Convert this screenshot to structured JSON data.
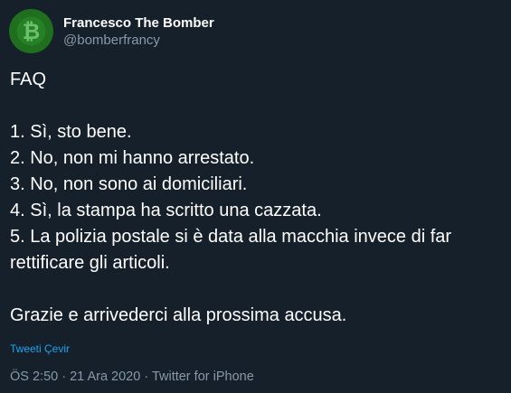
{
  "author": {
    "display_name": "Francesco The Bomber",
    "handle": "@bomberfrancy"
  },
  "tweet": {
    "lines": [
      "FAQ",
      "",
      "1. Sì, sto bene.",
      "2. No, non mi hanno arrestato.",
      "3. No, non sono ai domiciliari.",
      "4. Sì, la stampa ha scritto una cazzata.",
      "5. La polizia postale si è data alla macchia invece di far",
      "rettificare gli articoli.",
      "",
      "Grazie e arrivederci alla prossima accusa."
    ],
    "translate_label": "Tweeti Çevir",
    "time": "ÖS 2:50",
    "date": "21 Ara 2020",
    "source": "Twitter for iPhone",
    "separator": " · "
  },
  "colors": {
    "background": "#15202b",
    "text": "#ffffff",
    "secondary_text": "#8899a6",
    "link": "#1da1f2",
    "avatar_green": "#1e6b1e"
  },
  "icons": {
    "avatar_logo": "bitcoin-icon"
  }
}
